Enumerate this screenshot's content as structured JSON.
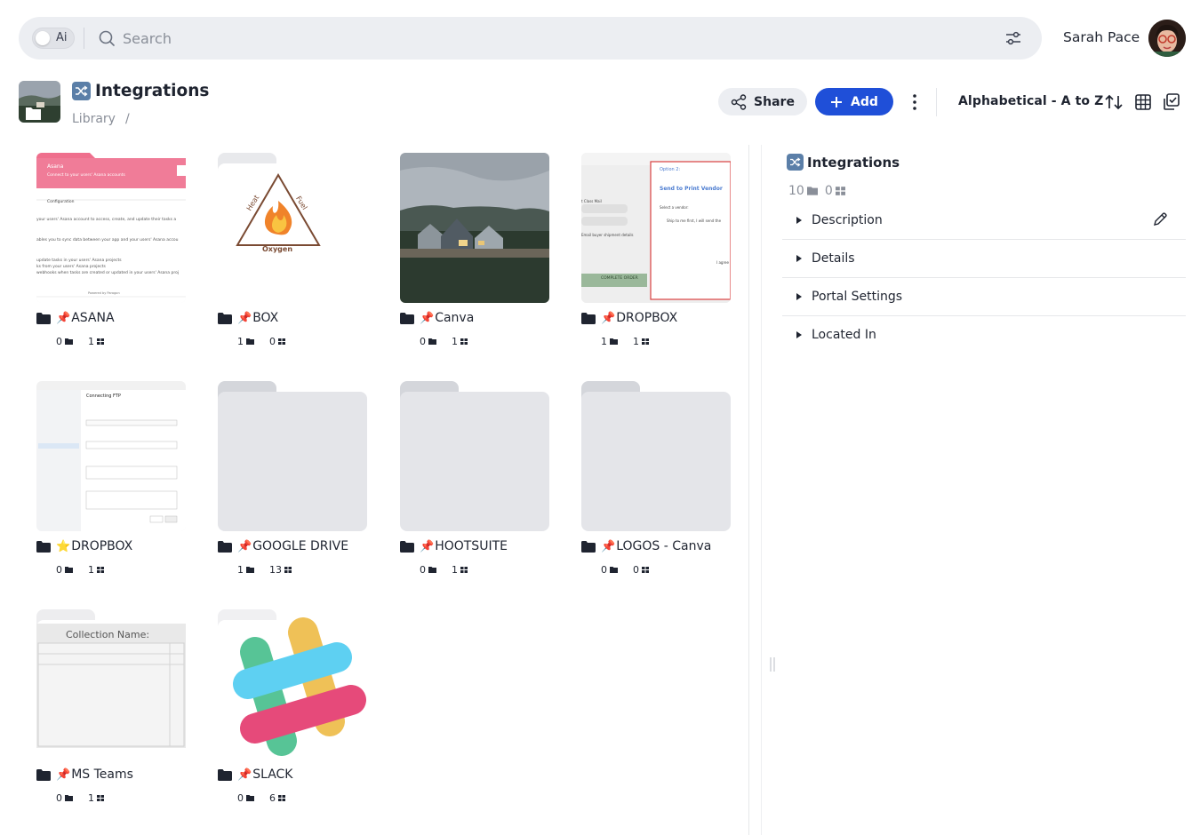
{
  "search": {
    "ai_label": "Ai",
    "placeholder": "Search"
  },
  "user": {
    "name": "Sarah Pace"
  },
  "header": {
    "title": "Integrations",
    "breadcrumb": "Library",
    "breadcrumb_sep": "/",
    "share_label": "Share",
    "add_label": "Add",
    "sort_label": "Alphabetical - A to Z"
  },
  "colors": {
    "accent": "#1f4fd8",
    "badge": "#5b7fa8",
    "pin": "#d62f2f"
  },
  "items": [
    {
      "name": "ASANA",
      "marker": "📌",
      "folders": "0",
      "assets": "1"
    },
    {
      "name": "BOX",
      "marker": "📌",
      "folders": "1",
      "assets": "0"
    },
    {
      "name": "Canva",
      "marker": "📌",
      "folders": "0",
      "assets": "1"
    },
    {
      "name": "DROPBOX",
      "marker": "📌",
      "folders": "1",
      "assets": "1"
    },
    {
      "name": "DROPBOX",
      "marker": "⭐",
      "folders": "0",
      "assets": "1"
    },
    {
      "name": "GOOGLE DRIVE",
      "marker": "📌",
      "folders": "1",
      "assets": "13"
    },
    {
      "name": "HOOTSUITE",
      "marker": "📌",
      "folders": "0",
      "assets": "1"
    },
    {
      "name": "LOGOS - Canva",
      "marker": "📌",
      "folders": "0",
      "assets": "0"
    },
    {
      "name": "MS Teams",
      "marker": "📌",
      "folders": "0",
      "assets": "1"
    },
    {
      "name": "SLACK",
      "marker": "📌",
      "folders": "0",
      "assets": "6"
    }
  ],
  "thumb_text": {
    "asana_brand": "Asana",
    "asana_sub": "Connect to your users' Asana accounts",
    "asana_config": "Configuration",
    "asana_line1": "your users' Asana account to access, create, and update their tasks a",
    "asana_line2": "ables you to sync data between your app and your users' Asana accou",
    "asana_line3": "update tasks in your users' Asana projects",
    "asana_line4": "ks from your users' Asana projects",
    "asana_line5": "webhooks when tasks are created or updated in your users' Asana proj",
    "asana_powered": "Powered by  Paragon",
    "box_heat": "Heat",
    "box_fuel": "Fuel",
    "box_oxygen": "Oxygen",
    "dropbox_option": "Option 2:",
    "dropbox_send": "Send to Print Vendor",
    "dropbox_class": "t Class Mail",
    "dropbox_select": "Select a vendor:",
    "dropbox_ship": "Ship to me first, I will send the",
    "dropbox_email": "Email buyer shipment details",
    "dropbox_complete": "COMPLETE ORDER",
    "dropbox_agree": "I agree",
    "ftp_title": "Connecting FTP",
    "teams_collection": "Collection Name:"
  },
  "panel": {
    "title": "Integrations",
    "folders": "10",
    "assets": "0",
    "sections": [
      "Description",
      "Details",
      "Portal Settings",
      "Located In"
    ]
  }
}
